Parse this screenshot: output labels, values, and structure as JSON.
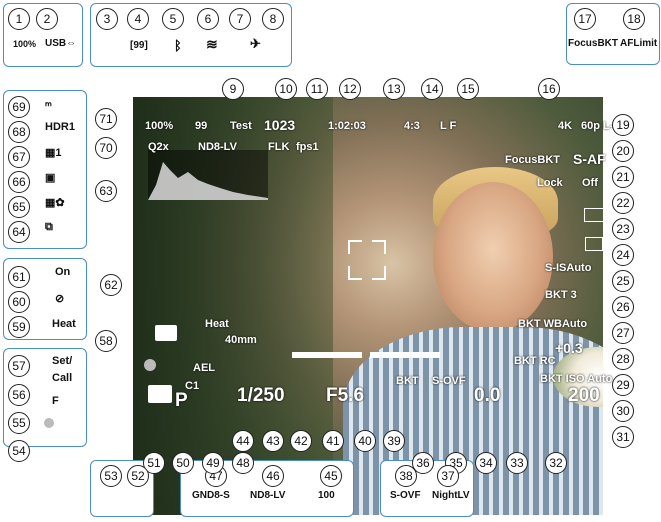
{
  "callouts": [
    "1",
    "2",
    "3",
    "4",
    "5",
    "6",
    "7",
    "8",
    "9",
    "10",
    "11",
    "12",
    "13",
    "14",
    "15",
    "16",
    "17",
    "18",
    "19",
    "20",
    "21",
    "22",
    "23",
    "24",
    "25",
    "26",
    "27",
    "28",
    "29",
    "30",
    "31",
    "32",
    "33",
    "34",
    "35",
    "36",
    "37",
    "38",
    "39",
    "40",
    "41",
    "42",
    "43",
    "44",
    "45",
    "46",
    "47",
    "48",
    "49",
    "50",
    "51",
    "52",
    "53",
    "54",
    "55",
    "56",
    "57",
    "58",
    "59",
    "60",
    "61",
    "62",
    "63",
    "64",
    "65",
    "66",
    "67",
    "68",
    "69",
    "70",
    "71"
  ],
  "top_icons": {
    "battery_pct": "100%",
    "usb": "USB⇔",
    "card_count": "[99]",
    "bt": "ᛒ",
    "wifi": "≋",
    "airplane": "✈"
  },
  "top_right_icons": {
    "focus_bkt": "FocusBKT",
    "af_limit": "AFLimit"
  },
  "left_icons": {
    "i69": "ₘ",
    "i68": "HDR1",
    "i67": "▦1",
    "i66": "▣",
    "i65": "▦✿",
    "i64": "⧉"
  },
  "left_icons2": {
    "i61": "On",
    "i60": "⊘",
    "i59": "Heat"
  },
  "left_icons3": {
    "i57a": "Set/",
    "i57b": "Call",
    "i56": "F"
  },
  "bottom_boxes": {
    "gnd": "GND8-S",
    "nd": "ND8-LV",
    "seq": "100",
    "sovf": "S-OVF",
    "night": "NightLV"
  },
  "overlay": {
    "batt": "100%",
    "shots": "99",
    "test": "Test",
    "count": "1023",
    "time": "1:02:03",
    "aspect": "4:3",
    "quality": "L F",
    "video": "4K",
    "fps": "60p L-8",
    "zoom": "Q2x",
    "nd": "ND8-LV",
    "flk": "FLK",
    "fps1": "fps1",
    "focus_bkt": "FocusBKT",
    "saf": "S-AF",
    "lock": "Lock",
    "iso_off": "Off",
    "sis": "S-ISAuto",
    "bkt_art": "BKT 3",
    "bkt_wb": "BKT WBAuto",
    "flash_comp": "+0.3",
    "iso": "200",
    "bkt_rc": "BKT RC",
    "bkt_iso": "BKT ISO Auto",
    "ev": "0.0",
    "f": "F5.6",
    "shutter": "1/250",
    "ael": "AEL",
    "c1": "C1",
    "mode": "P",
    "focal": "40mm",
    "heat": "Heat",
    "sovf": "S-OVF",
    "bkt": "BKT"
  }
}
